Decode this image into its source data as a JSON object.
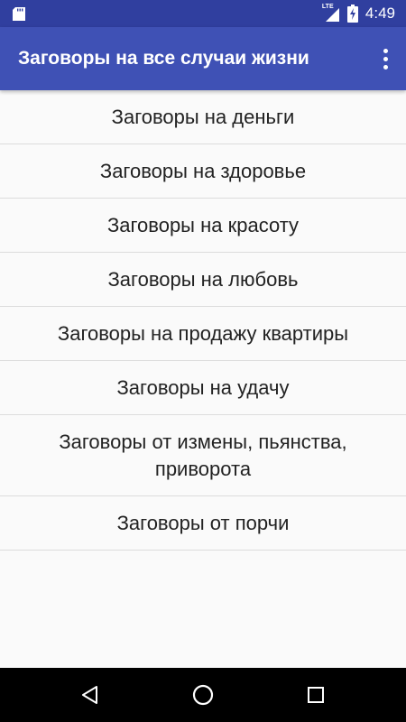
{
  "status_bar": {
    "network_label": "LTE",
    "time": "4:49",
    "icons": [
      "sd-card-icon",
      "signal-icon",
      "battery-charging-icon"
    ]
  },
  "app_bar": {
    "title": "Заговоры на все случаи жизни",
    "overflow_icon": "more-vert-icon"
  },
  "list": {
    "items": [
      {
        "label": "Заговоры на деньги"
      },
      {
        "label": "Заговоры на здоровье"
      },
      {
        "label": "Заговоры на красоту"
      },
      {
        "label": "Заговоры на любовь"
      },
      {
        "label": "Заговоры на продажу квартиры"
      },
      {
        "label": "Заговоры на удачу"
      },
      {
        "label": "Заговоры от измены, пьянства, приворота"
      },
      {
        "label": "Заговоры от порчи"
      }
    ]
  },
  "nav_bar": {
    "icons": [
      "back-icon",
      "home-icon",
      "recents-icon"
    ]
  },
  "colors": {
    "status_bar": "#303f9f",
    "app_bar": "#3f51b5",
    "background": "#fafafa",
    "divider": "#dcdcdc",
    "text": "#222222",
    "nav_bar": "#000000"
  }
}
